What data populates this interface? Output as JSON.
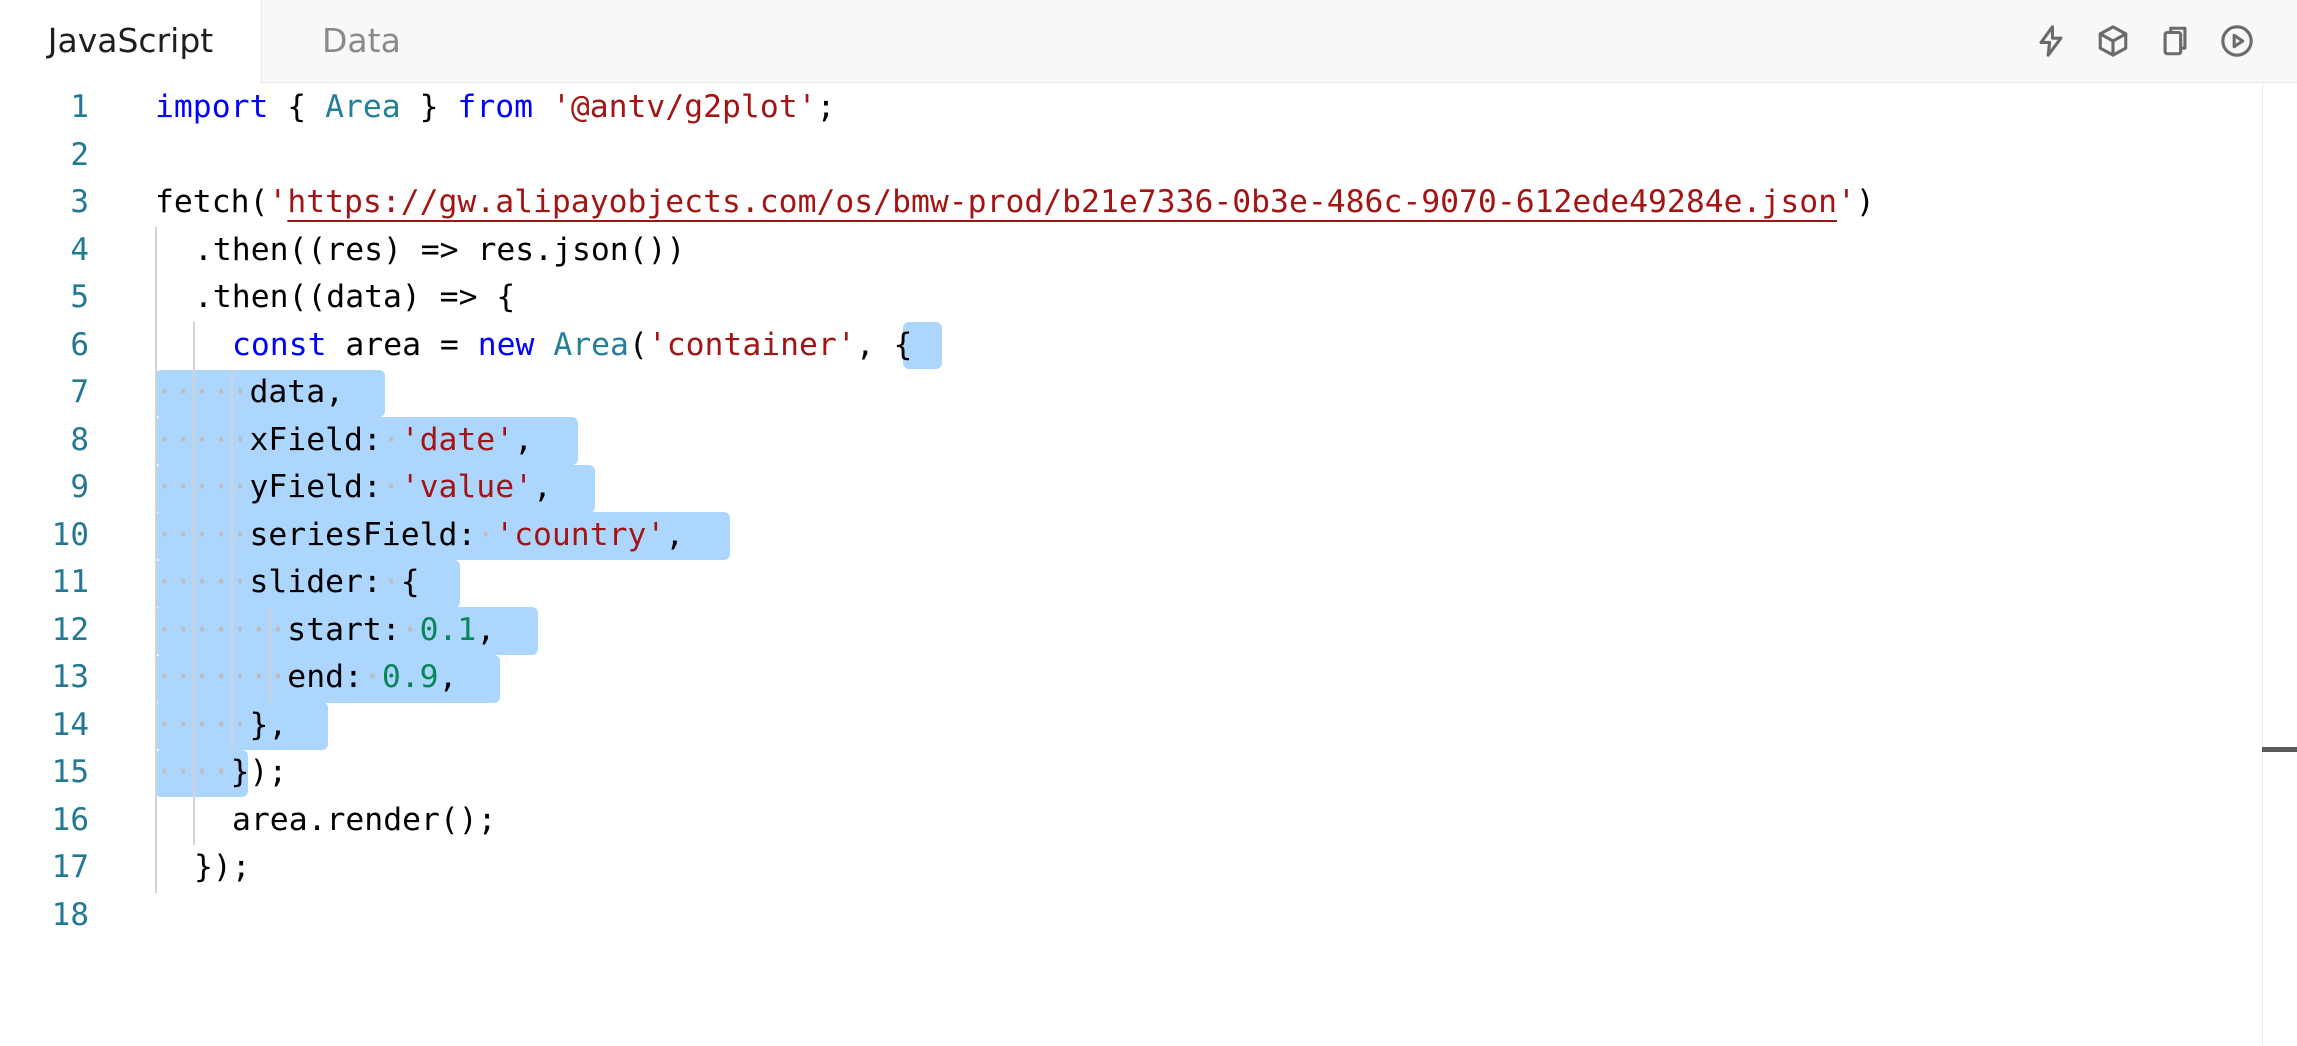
{
  "tabs": {
    "active_label": "JavaScript",
    "inactive_label": "Data"
  },
  "toolbar_icons": [
    "lightning-icon",
    "cube-icon",
    "copy-icon",
    "play-icon"
  ],
  "line_numbers": [
    "1",
    "2",
    "3",
    "4",
    "5",
    "6",
    "7",
    "8",
    "9",
    "10",
    "11",
    "12",
    "13",
    "14",
    "15",
    "16",
    "17",
    "18"
  ],
  "code": {
    "l1": {
      "import": "import",
      "open": " { ",
      "cls": "Area",
      "close": " } ",
      "from": "from",
      "sp": " ",
      "str": "'@antv/g2plot'",
      "end": ";"
    },
    "l3": {
      "fn": "fetch(",
      "q1": "'",
      "url": "https://gw.alipayobjects.com/os/bmw-prod/b21e7336-0b3e-486c-9070-612ede49284e.json",
      "q2": "'",
      "end": ")"
    },
    "l4": {
      "text": ".then((res) => res.json())"
    },
    "l5": {
      "text": ".then((data) => {"
    },
    "l6": {
      "const": "const",
      "mid": " area = ",
      "new": "new",
      "sp": " ",
      "cls": "Area",
      "po": "(",
      "str": "'container'",
      "end": ", {"
    },
    "l7": {
      "ws": "·····",
      "text": "data,"
    },
    "l8": {
      "ws": "·····",
      "key": "xField:",
      "sp": "·",
      "str": "'date'",
      "end": ","
    },
    "l9": {
      "ws": "·····",
      "key": "yField:",
      "sp": "·",
      "str": "'value'",
      "end": ","
    },
    "l10": {
      "ws": "·····",
      "key": "seriesField:",
      "sp": "·",
      "str": "'country'",
      "end": ","
    },
    "l11": {
      "ws": "·····",
      "key": "slider:",
      "sp": "·",
      "end": "{"
    },
    "l12": {
      "ws": "·······",
      "key": "start:",
      "sp": "·",
      "num": "0.1",
      "end": ","
    },
    "l13": {
      "ws": "·······",
      "key": "end:",
      "sp": "·",
      "num": "0.9",
      "end": ","
    },
    "l14": {
      "ws": "·····",
      "text": "},"
    },
    "l15": {
      "ws": "····",
      "text": "});"
    },
    "l16": {
      "text": "area.render();"
    },
    "l17": {
      "text": "});"
    }
  },
  "colors": {
    "keyword": "#0000ff",
    "class": "#267f99",
    "string": "#a31515",
    "number": "#098658",
    "line_number": "#237893",
    "selection": "#add6ff"
  }
}
